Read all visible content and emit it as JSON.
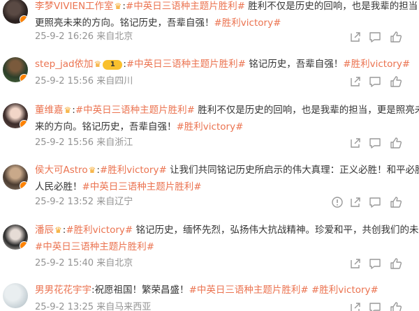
{
  "comments": [
    {
      "username": "李梦VIVIEN工作室",
      "text_prefix": ":",
      "line1_topic": "#中英日三语种主题片胜利#",
      "line1_rest": " 胜利不仅是历史的回响，也是我辈的担当，",
      "line2_text": "更照亮未来的方向。铭记历史，吾辈自强！",
      "line2_topic": "#胜利victory#",
      "date": "25-9-2 16:26",
      "location": "来自北京",
      "icons": [
        "crown-icon",
        "share-icon",
        "reply-icon",
        "like-icon"
      ]
    },
    {
      "username": "step_jad依加",
      "level": "1",
      "text_prefix": ":",
      "line1_topic": "#中英日三语种主题片胜利#",
      "line1_rest": " 铭记历史，吾辈自强！",
      "line1_topic2": "#胜利victory#",
      "date": "25-9-2 15:56",
      "location": "来自四川",
      "icons": [
        "crown-icon",
        "share-icon",
        "reply-icon",
        "like-icon"
      ]
    },
    {
      "username": "董维嘉",
      "text_prefix": ":",
      "line1_topic": "#中英日三语种主题片胜利#",
      "line1_rest": " 胜利不仅是历史的回响，也是我辈的担当，更是照亮未",
      "line2_text": "来的方向。铭记历史，吾辈自强！",
      "line2_topic": "#胜利victory#",
      "date": "25-9-2 15:56",
      "location": "来自浙江",
      "icons": [
        "crown-icon",
        "share-icon",
        "reply-icon",
        "like-icon"
      ]
    },
    {
      "username": "侯大可Astro",
      "text_prefix": ":",
      "line1_topic": "#胜利victory#",
      "line1_rest": " 让我们共同铭记历史所启示的伟大真理：正义必胜！和平必胜",
      "line2_text": "人民必胜！",
      "line2_topic": "#中英日三语种主题片胜利#",
      "date": "25-9-2 13:52",
      "location": "来自辽宁",
      "icons": [
        "crown-icon",
        "warn-icon",
        "share-icon",
        "reply-icon",
        "like-icon"
      ]
    },
    {
      "username": "潘辰",
      "text_prefix": ":",
      "line1_topic": "#胜利victory#",
      "line1_rest": " 铭记历史，缅怀先烈，弘扬伟大抗战精神。珍爱和平，共创我们的未来！",
      "line2_topic": "#中英日三语种主题片胜利#",
      "date": "25-9-2 15:40",
      "location": "来自北京",
      "icons": [
        "crown-icon",
        "share-icon",
        "reply-icon",
        "like-icon"
      ]
    },
    {
      "username": "男男花花宇宇",
      "text_prefix": ":祝愿祖国！繁荣昌盛！",
      "line1_topic": "#中英日三语种主题片胜利#",
      "line1_topic2": "#胜利victory#",
      "date": "25-9-2 13:25",
      "location": "来自马来西亚",
      "icons": [
        "share-icon",
        "reply-icon",
        "like-icon"
      ]
    }
  ],
  "colors": {
    "accent": "#eb7350",
    "meta": "#939393",
    "text": "#333333",
    "badge": "#ff8200"
  }
}
